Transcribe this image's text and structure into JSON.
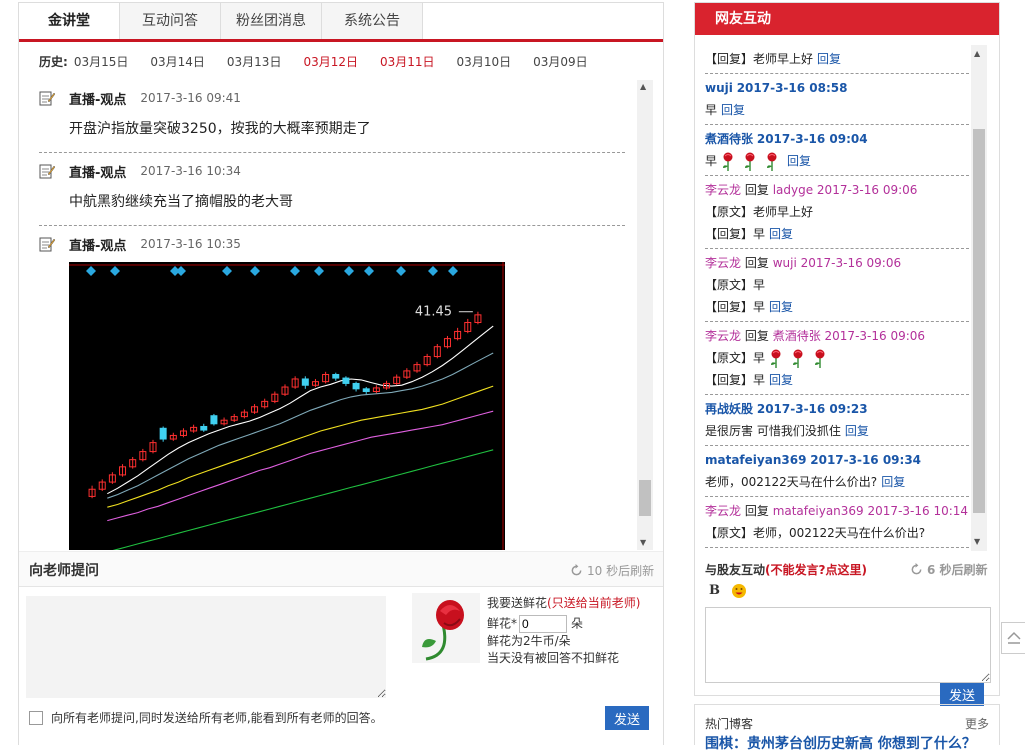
{
  "tabs": [
    "金讲堂",
    "互动问答",
    "粉丝团消息",
    "系统公告"
  ],
  "history": {
    "label": "历史:",
    "dates": [
      {
        "text": "03月15日",
        "color": "#444444"
      },
      {
        "text": "03月14日",
        "color": "#444444"
      },
      {
        "text": "03月13日",
        "color": "#444444"
      },
      {
        "text": "03月12日",
        "color": "#c81623"
      },
      {
        "text": "03月11日",
        "color": "#c81623"
      },
      {
        "text": "03月10日",
        "color": "#444444"
      },
      {
        "text": "03月09日",
        "color": "#444444"
      }
    ]
  },
  "posts": [
    {
      "author": "直播-观点",
      "time": "2017-3-16 09:41",
      "text": "开盘沪指放量突破3250，按我的大概率预期走了"
    },
    {
      "author": "直播-观点",
      "time": "2017-3-16 10:34",
      "text": "中航黑豹继续充当了摘帽股的老大哥"
    },
    {
      "author": "直播-观点",
      "time": "2017-3-16 10:35",
      "text": ""
    }
  ],
  "chart_data": {
    "type": "candlestick",
    "price_label": "41.45",
    "candles": [
      {
        "o": 21.2,
        "c": 22.0,
        "h": 22.4,
        "l": 21.0
      },
      {
        "o": 22.0,
        "c": 22.8,
        "h": 23.1,
        "l": 21.8
      },
      {
        "o": 22.8,
        "c": 23.6,
        "h": 23.9,
        "l": 22.6
      },
      {
        "o": 23.6,
        "c": 24.5,
        "h": 24.8,
        "l": 23.4
      },
      {
        "o": 24.5,
        "c": 25.3,
        "h": 25.6,
        "l": 24.3
      },
      {
        "o": 25.3,
        "c": 26.2,
        "h": 26.5,
        "l": 25.1
      },
      {
        "o": 26.2,
        "c": 27.2,
        "h": 27.5,
        "l": 26.0
      },
      {
        "o": 28.8,
        "c": 27.6,
        "h": 29.0,
        "l": 27.3
      },
      {
        "o": 27.6,
        "c": 28.0,
        "h": 28.3,
        "l": 27.4
      },
      {
        "o": 28.0,
        "c": 28.5,
        "h": 28.8,
        "l": 27.8
      },
      {
        "o": 28.5,
        "c": 28.9,
        "h": 29.2,
        "l": 28.3
      },
      {
        "o": 29.0,
        "c": 28.6,
        "h": 29.3,
        "l": 28.4
      },
      {
        "o": 30.2,
        "c": 29.3,
        "h": 30.4,
        "l": 29.1
      },
      {
        "o": 29.3,
        "c": 29.7,
        "h": 30.0,
        "l": 29.1
      },
      {
        "o": 29.7,
        "c": 30.1,
        "h": 30.4,
        "l": 29.5
      },
      {
        "o": 30.1,
        "c": 30.6,
        "h": 30.9,
        "l": 29.9
      },
      {
        "o": 30.6,
        "c": 31.2,
        "h": 31.5,
        "l": 30.4
      },
      {
        "o": 31.2,
        "c": 31.8,
        "h": 32.1,
        "l": 31.0
      },
      {
        "o": 31.8,
        "c": 32.6,
        "h": 32.9,
        "l": 31.6
      },
      {
        "o": 32.6,
        "c": 33.4,
        "h": 33.7,
        "l": 32.4
      },
      {
        "o": 33.4,
        "c": 34.3,
        "h": 34.6,
        "l": 33.2
      },
      {
        "o": 34.3,
        "c": 33.6,
        "h": 34.6,
        "l": 33.2
      },
      {
        "o": 33.6,
        "c": 34.0,
        "h": 34.3,
        "l": 33.4
      },
      {
        "o": 34.0,
        "c": 34.8,
        "h": 35.1,
        "l": 33.8
      },
      {
        "o": 34.8,
        "c": 34.4,
        "h": 35.0,
        "l": 34.1
      },
      {
        "o": 34.4,
        "c": 33.8,
        "h": 34.6,
        "l": 33.5
      },
      {
        "o": 33.8,
        "c": 33.2,
        "h": 34.0,
        "l": 32.9
      },
      {
        "o": 33.2,
        "c": 32.9,
        "h": 33.4,
        "l": 32.6
      },
      {
        "o": 32.9,
        "c": 33.3,
        "h": 33.6,
        "l": 32.7
      },
      {
        "o": 33.3,
        "c": 33.8,
        "h": 34.1,
        "l": 33.1
      },
      {
        "o": 33.8,
        "c": 34.5,
        "h": 34.8,
        "l": 33.6
      },
      {
        "o": 34.5,
        "c": 35.2,
        "h": 35.5,
        "l": 34.3
      },
      {
        "o": 35.2,
        "c": 35.9,
        "h": 36.2,
        "l": 35.0
      },
      {
        "o": 35.9,
        "c": 36.8,
        "h": 37.1,
        "l": 35.7
      },
      {
        "o": 36.8,
        "c": 37.9,
        "h": 38.2,
        "l": 36.6
      },
      {
        "o": 37.9,
        "c": 38.8,
        "h": 39.1,
        "l": 37.7
      },
      {
        "o": 38.8,
        "c": 39.6,
        "h": 40.0,
        "l": 38.6
      },
      {
        "o": 39.6,
        "c": 40.6,
        "h": 41.0,
        "l": 39.4
      },
      {
        "o": 40.6,
        "c": 41.45,
        "h": 41.8,
        "l": 40.4
      }
    ],
    "ma": [
      {
        "color": "#ffffff",
        "values": [
          21.5,
          22.1,
          22.8,
          23.5,
          24.3,
          25.1,
          25.9,
          26.6,
          27.2,
          27.7,
          28.2,
          28.6,
          29.0,
          29.3,
          29.6,
          30.0,
          30.5,
          31.0,
          31.6,
          32.3,
          33.0,
          33.4,
          33.7,
          34.1,
          34.3,
          34.2,
          33.9,
          33.6,
          33.5,
          33.6,
          34.0,
          34.5,
          35.1,
          35.8,
          36.6,
          37.5,
          38.4,
          39.3,
          40.2
        ]
      },
      {
        "color": "#7fa9b8",
        "values": [
          21.0,
          21.4,
          21.9,
          22.4,
          23.0,
          23.6,
          24.2,
          24.8,
          25.4,
          25.9,
          26.4,
          26.9,
          27.3,
          27.7,
          28.1,
          28.5,
          28.9,
          29.3,
          29.8,
          30.3,
          30.8,
          31.2,
          31.6,
          32.0,
          32.3,
          32.5,
          32.6,
          32.7,
          32.8,
          33.0,
          33.2,
          33.5,
          33.9,
          34.3,
          34.8,
          35.4,
          36.0,
          36.6,
          37.2
        ]
      },
      {
        "color": "#f0e020",
        "values": [
          20.0,
          20.3,
          20.7,
          21.1,
          21.5,
          21.9,
          22.4,
          22.8,
          23.3,
          23.7,
          24.1,
          24.5,
          24.9,
          25.3,
          25.7,
          26.1,
          26.5,
          26.9,
          27.3,
          27.7,
          28.1,
          28.5,
          28.8,
          29.1,
          29.4,
          29.7,
          29.9,
          30.1,
          30.3,
          30.5,
          30.7,
          30.9,
          31.2,
          31.5,
          31.9,
          32.3,
          32.7,
          33.1,
          33.5
        ]
      },
      {
        "color": "#e060e0",
        "values": [
          18.5,
          18.8,
          19.1,
          19.4,
          19.8,
          20.1,
          20.5,
          20.9,
          21.3,
          21.7,
          22.1,
          22.5,
          22.9,
          23.3,
          23.7,
          24.1,
          24.4,
          24.8,
          25.2,
          25.6,
          26.0,
          26.3,
          26.6,
          26.9,
          27.2,
          27.5,
          27.8,
          28.0,
          28.2,
          28.4,
          28.6,
          28.8,
          29.0,
          29.2,
          29.5,
          29.8,
          30.1,
          30.4,
          30.7
        ]
      },
      {
        "color": "#20c040",
        "values": [
          15.0,
          15.3,
          15.6,
          15.9,
          16.2,
          16.5,
          16.8,
          17.1,
          17.4,
          17.7,
          18.0,
          18.3,
          18.6,
          18.9,
          19.2,
          19.5,
          19.8,
          20.1,
          20.4,
          20.7,
          21.0,
          21.3,
          21.6,
          21.9,
          22.2,
          22.5,
          22.8,
          23.1,
          23.4,
          23.7,
          24.0,
          24.3,
          24.6,
          24.9,
          25.2,
          25.5,
          25.8,
          26.1,
          26.4
        ]
      }
    ],
    "ylim": [
      15,
      44
    ]
  },
  "ask": {
    "title": "向老师提问",
    "refresh": "10 秒后刷新",
    "flower_line1": "我要送鲜花",
    "flower_line1_note": "(只送给当前老师)",
    "flower_count_label": "鲜花*",
    "flower_count_value": "0",
    "flower_unit": "朵",
    "flower_price": "鲜花为2牛币/朵",
    "flower_rule": "当天没有被回答不扣鲜花",
    "broadcast_label": "向所有老师提问,同时发送给所有老师,能看到所有老师的回答。",
    "send_label": "发送"
  },
  "right": {
    "title": "网友互动",
    "messages": [
      {
        "lines": [
          {
            "text": "【回复】老师早上好",
            "reply": "回复"
          }
        ]
      },
      {
        "user": "wuji",
        "time": "2017-3-16 08:58",
        "color": "u",
        "lines": [
          {
            "text": "早",
            "reply": "回复"
          }
        ]
      },
      {
        "user": "煮酒待张",
        "time": "2017-3-16 09:04",
        "color": "u",
        "lines": [
          {
            "text": "早",
            "roses": 3,
            "reply": "回复"
          }
        ]
      },
      {
        "user": "李云龙",
        "to": "ladyge",
        "time": "2017-3-16 09:06",
        "color": "m",
        "lines": [
          {
            "text": "【原文】老师早上好"
          },
          {
            "text": "【回复】早",
            "reply": "回复"
          }
        ]
      },
      {
        "user": "李云龙",
        "to": "wuji",
        "time": "2017-3-16 09:06",
        "color": "m",
        "lines": [
          {
            "text": "【原文】早"
          },
          {
            "text": "【回复】早",
            "reply": "回复"
          }
        ]
      },
      {
        "user": "李云龙",
        "to": "煮酒待张",
        "time": "2017-3-16 09:06",
        "color": "m",
        "lines": [
          {
            "text": "【原文】早",
            "roses": 3
          },
          {
            "text": "【回复】早",
            "reply": "回复"
          }
        ]
      },
      {
        "user": "再战妖股",
        "time": "2017-3-16 09:23",
        "color": "u",
        "lines": [
          {
            "text": "是很厉害 可惜我们没抓住",
            "reply": "回复"
          }
        ]
      },
      {
        "user": "matafeiyan369",
        "time": "2017-3-16 09:34",
        "color": "u",
        "lines": [
          {
            "text": "老师，002122天马在什么价出?",
            "reply": "回复"
          }
        ]
      },
      {
        "user": "李云龙",
        "to": "matafeiyan369",
        "time": "2017-3-16 10:14",
        "color": "m",
        "lines": [
          {
            "text": "【原文】老师，002122天马在什么价出?"
          }
        ]
      }
    ],
    "reply_word": "回复",
    "friend_title": "与股友互动",
    "friend_note": "(不能发言?点这里)",
    "friend_refresh": "6 秒后刷新",
    "bold_tool": "B",
    "send_label": "发送"
  },
  "blog": {
    "title": "热门博客",
    "more": "更多",
    "headline": "围棋：贵州茅台创历史新高 你想到了什么？"
  }
}
